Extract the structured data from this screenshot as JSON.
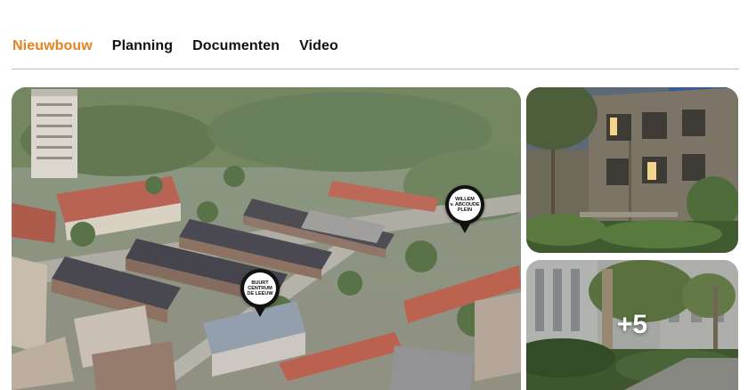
{
  "tabs": [
    {
      "label": "Nieuwbouw",
      "active": true
    },
    {
      "label": "Planning",
      "active": false
    },
    {
      "label": "Documenten",
      "active": false
    },
    {
      "label": "Video",
      "active": false
    }
  ],
  "colors": {
    "active_tab": "#e8821e",
    "tab_text": "#111111",
    "divider": "#bdbdbd"
  },
  "gallery": {
    "main_photo": {
      "subject": "aerial-neighbourhood-photo",
      "markers": [
        {
          "label": "WILLEM\nv. ABCOUDE\nPLEIN"
        },
        {
          "label": "BUURT\nCENTRUM\nDE LEEUW"
        }
      ]
    },
    "side_top_photo": {
      "subject": "apartment-building-garden-photo"
    },
    "side_bottom_photo": {
      "subject": "courtyard-trees-photo",
      "more_count_label": "+5"
    }
  }
}
